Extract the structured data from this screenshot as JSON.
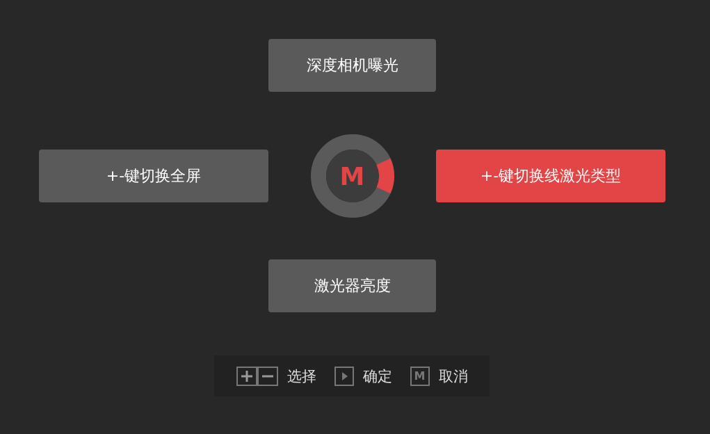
{
  "menu_items": [
    {
      "label": "深度相机曝光",
      "kind": "top",
      "selected": false
    },
    {
      "label": "+-键切换全屏",
      "kind": "left",
      "selected": false
    },
    {
      "label": "+-键切换线激光类型",
      "kind": "right",
      "selected": true
    },
    {
      "label": "激光器亮度",
      "kind": "bottom",
      "selected": false
    }
  ],
  "dial": {
    "label": "M"
  },
  "hints": [
    {
      "kind": "plus-minus",
      "text": "选择"
    },
    {
      "kind": "play",
      "text": "确定"
    },
    {
      "kind": "letter",
      "key": "M",
      "text": "取消"
    }
  ]
}
